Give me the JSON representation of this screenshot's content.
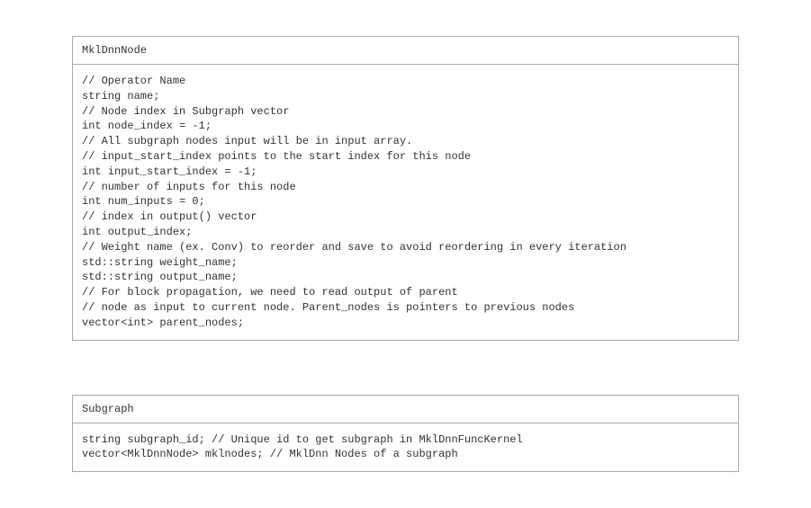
{
  "box1": {
    "title": "MklDnnNode",
    "body": "// Operator Name\nstring name;\n// Node index in Subgraph vector\nint node_index = -1;\n// All subgraph nodes input will be in input array.\n// input_start_index points to the start index for this node\nint input_start_index = -1;\n// number of inputs for this node\nint num_inputs = 0;\n// index in output() vector\nint output_index;\n// Weight name (ex. Conv) to reorder and save to avoid reordering in every iteration\nstd::string weight_name;\nstd::string output_name;\n// For block propagation, we need to read output of parent\n// node as input to current node. Parent_nodes is pointers to previous nodes\nvector<int> parent_nodes;"
  },
  "box2": {
    "title": "Subgraph",
    "body": "string subgraph_id; // Unique id to get subgraph in MklDnnFuncKernel\nvector<MklDnnNode> mklnodes; // MklDnn Nodes of a subgraph"
  }
}
